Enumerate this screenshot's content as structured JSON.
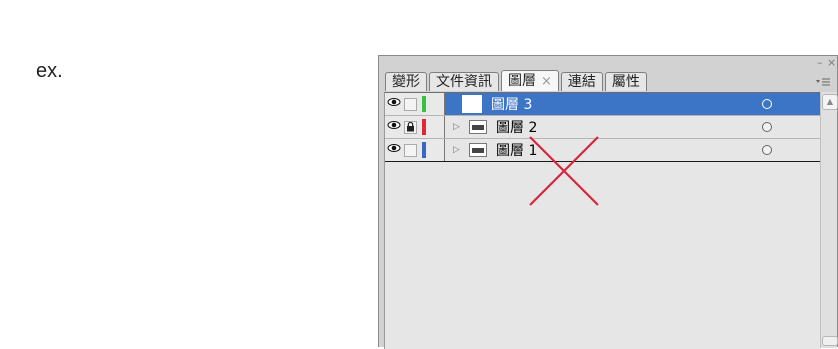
{
  "caption": "ex.",
  "panel": {
    "minimize": "–",
    "close": "×",
    "menu_icon": "menu-lines-icon",
    "tabs": [
      {
        "label": "變形",
        "active": false
      },
      {
        "label": "文件資訊",
        "active": false
      },
      {
        "label": "圖層",
        "active": true,
        "close": "×"
      },
      {
        "label": "連結",
        "active": false
      },
      {
        "label": "屬性",
        "active": false
      }
    ]
  },
  "layers": [
    {
      "name": "圖層 3",
      "selected": true,
      "color": "#3fbf3f",
      "visible": true,
      "locked": false,
      "expandable": false
    },
    {
      "name": "圖層 2",
      "selected": false,
      "color": "#e0263a",
      "visible": true,
      "locked": true,
      "expandable": true
    },
    {
      "name": "圖層 1",
      "selected": false,
      "color": "#3467c8",
      "visible": true,
      "locked": false,
      "expandable": true
    }
  ],
  "annotation": {
    "mark": "red-x",
    "color": "#d7263d"
  },
  "icons": {
    "eye": "eye-icon",
    "lock": "lock-icon",
    "expand": "triangle-right-icon",
    "thumbnail": "layer-thumbnail-icon",
    "target": "target-circle-icon"
  }
}
